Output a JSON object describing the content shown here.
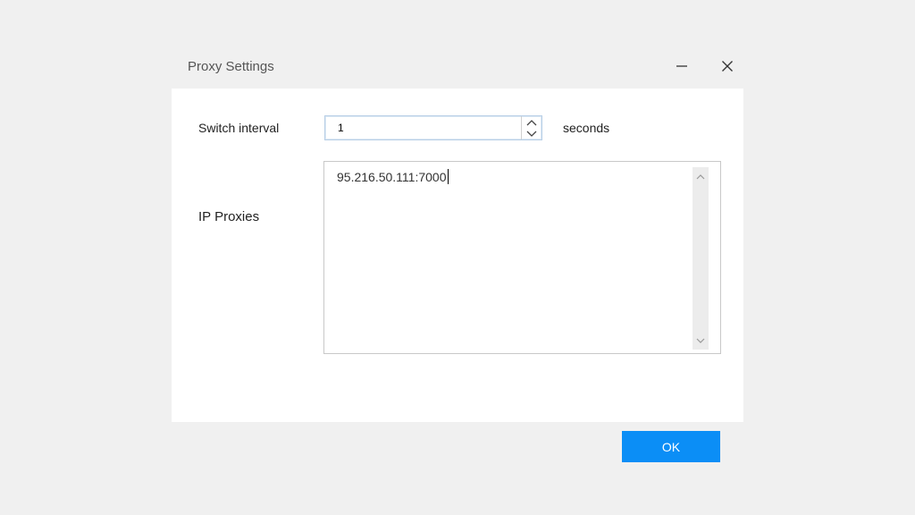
{
  "window": {
    "title": "Proxy Settings",
    "minimize_icon": "minimize-icon",
    "close_icon": "close-icon"
  },
  "form": {
    "interval_label": "Switch interval",
    "interval_value": "1",
    "interval_unit": "seconds",
    "proxies_label": "IP Proxies",
    "proxies_value": "95.216.50.111:7000"
  },
  "actions": {
    "ok_label": "OK"
  },
  "colors": {
    "accent": "#0b8ef6",
    "background": "#f0f0f0",
    "panel": "#ffffff"
  }
}
